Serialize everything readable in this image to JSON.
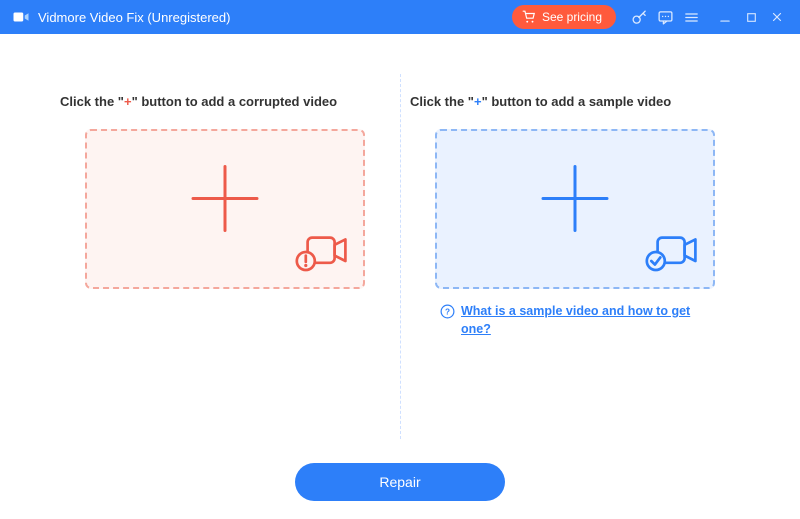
{
  "titlebar": {
    "title": "Vidmore Video Fix (Unregistered)",
    "pricing_label": "See pricing"
  },
  "left_panel": {
    "title_prefix": "Click the \"",
    "title_plus": "+",
    "title_suffix": "\" button to add a corrupted video"
  },
  "right_panel": {
    "title_prefix": "Click the \"",
    "title_plus": "+",
    "title_suffix": "\" button to add a sample video",
    "help_link": "What is a sample video and how to get one?"
  },
  "footer": {
    "repair_label": "Repair"
  },
  "colors": {
    "accent_blue": "#2d7ff9",
    "accent_orange": "#ff5a3c",
    "drop_red_border": "#f4a79c",
    "drop_blue_border": "#8db7f5"
  },
  "icons": {
    "logo": "app-logo-icon",
    "cart": "cart-icon",
    "key": "key-icon",
    "feedback": "chat-icon",
    "menu": "menu-icon",
    "minimize": "minimize-icon",
    "maximize": "maximize-icon",
    "close": "close-icon",
    "plus": "plus-icon",
    "camera_error": "camera-error-icon",
    "camera_ok": "camera-check-icon",
    "question": "question-icon"
  }
}
